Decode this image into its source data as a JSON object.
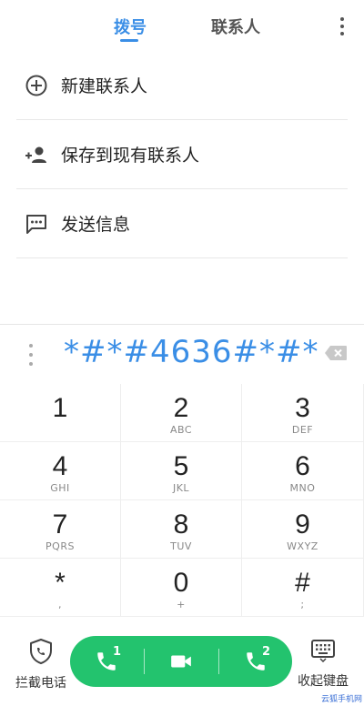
{
  "tabs": {
    "dial": "拨号",
    "contacts": "联系人"
  },
  "actions": {
    "new_contact": "新建联系人",
    "save_existing": "保存到现有联系人",
    "send_message": "发送信息"
  },
  "dialer": {
    "number": "*#*#4636#*#*"
  },
  "keys": [
    {
      "digit": "1",
      "letters": ""
    },
    {
      "digit": "2",
      "letters": "ABC"
    },
    {
      "digit": "3",
      "letters": "DEF"
    },
    {
      "digit": "4",
      "letters": "GHI"
    },
    {
      "digit": "5",
      "letters": "JKL"
    },
    {
      "digit": "6",
      "letters": "MNO"
    },
    {
      "digit": "7",
      "letters": "PQRS"
    },
    {
      "digit": "8",
      "letters": "TUV"
    },
    {
      "digit": "9",
      "letters": "WXYZ"
    },
    {
      "digit": "*",
      "letters": ","
    },
    {
      "digit": "0",
      "letters": "+"
    },
    {
      "digit": "#",
      "letters": ";"
    }
  ],
  "bottom": {
    "block_calls": "拦截电话",
    "hide_keypad": "收起键盘",
    "sim1": "1",
    "sim2": "2"
  },
  "watermark": "云狐手机网",
  "colors": {
    "accent": "#3a8ee6",
    "call_green": "#23c36e"
  }
}
